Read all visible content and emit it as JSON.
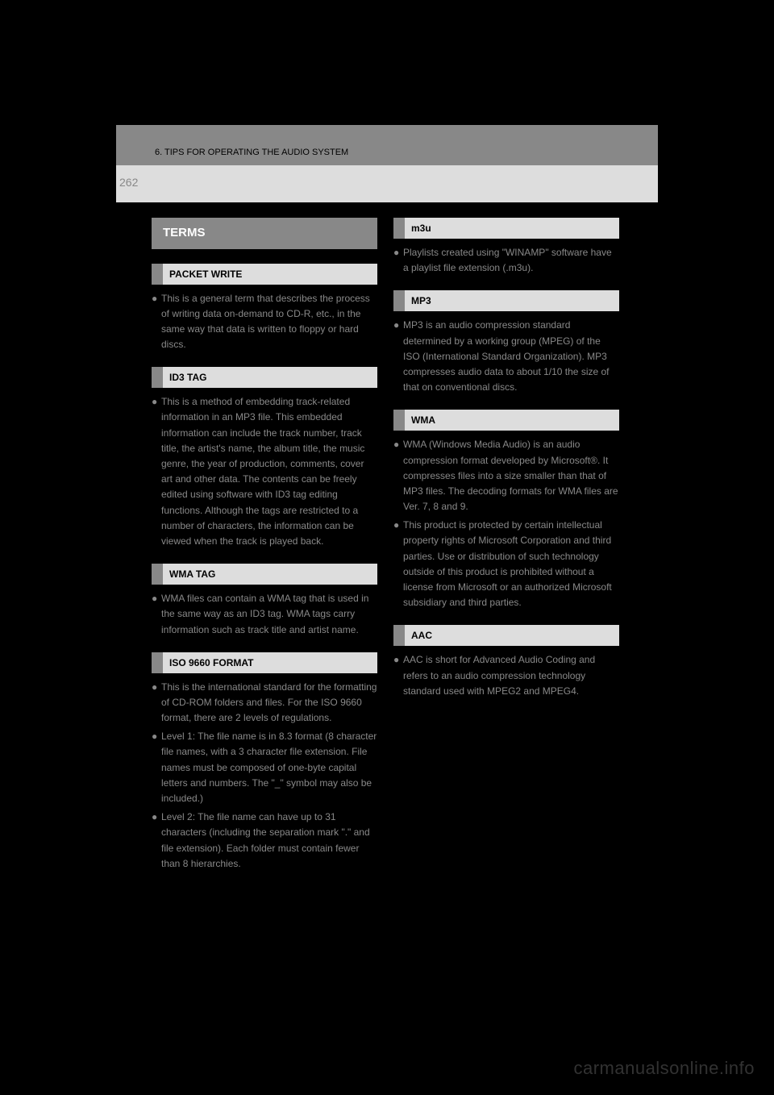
{
  "header": {
    "section": "6. TIPS FOR OPERATING THE AUDIO SYSTEM"
  },
  "page_number": "262",
  "terms_heading": "TERMS",
  "left_column": [
    {
      "label": "PACKET WRITE",
      "paragraphs": [
        "This is a general term that describes the process of writing data on-demand to CD-R, etc., in the same way that data is written to floppy or hard discs."
      ]
    },
    {
      "label": "ID3 TAG",
      "paragraphs": [
        "This is a method of embedding track-related information in an MP3 file. This embedded information can include the track number, track title, the artist's name, the album title, the music genre, the year of production, comments, cover art and other data. The contents can be freely edited using software with ID3 tag editing functions. Although the tags are restricted to a number of characters, the information can be viewed when the track is played back."
      ]
    },
    {
      "label": "WMA TAG",
      "paragraphs": [
        "WMA files can contain a WMA tag that is used in the same way as an ID3 tag. WMA tags carry information such as track title and artist name."
      ]
    },
    {
      "label": "ISO 9660 FORMAT",
      "paragraphs": [
        "This is the international standard for the formatting of CD-ROM folders and files. For the ISO 9660 format, there are 2 levels of regulations.",
        "Level 1: The file name is in 8.3 format (8 character file names, with a 3 character file extension. File names must be composed of one-byte capital letters and numbers. The \"_\" symbol may also be included.)",
        "Level 2: The file name can have up to 31 characters (including the separation mark \".\" and file extension). Each folder must contain fewer than 8 hierarchies."
      ]
    }
  ],
  "right_column": [
    {
      "label": "m3u",
      "paragraphs": [
        "Playlists created using \"WINAMP\" software have a playlist file extension (.m3u)."
      ]
    },
    {
      "label": "MP3",
      "paragraphs": [
        "MP3 is an audio compression standard determined by a working group (MPEG) of the ISO (International Standard Organization). MP3 compresses audio data to about 1/10 the size of that on conventional discs."
      ]
    },
    {
      "label": "WMA",
      "paragraphs": [
        "WMA (Windows Media Audio) is an audio compression format developed by Microsoft®. It compresses files into a size smaller than that of MP3 files. The decoding formats for WMA files are Ver. 7, 8 and 9.",
        "This product is protected by certain intellectual property rights of Microsoft Corporation and third parties. Use or distribution of such technology outside of this product is prohibited without a license from Microsoft or an authorized Microsoft subsidiary and third parties."
      ]
    },
    {
      "label": "AAC",
      "paragraphs": [
        "AAC is short for Advanced Audio Coding and refers to an audio compression technology standard used with MPEG2 and MPEG4."
      ]
    }
  ],
  "watermark": "carmanualsonline.info"
}
